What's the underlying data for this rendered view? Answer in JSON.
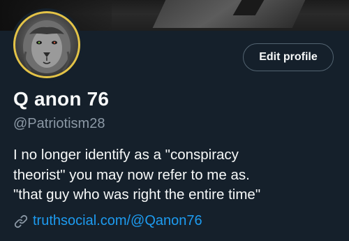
{
  "profile": {
    "edit_button_label": "Edit profile",
    "display_name": "Q anon 76",
    "handle": "@Patriotism28",
    "bio_lines": [
      "I no longer identify as a \"conspiracy",
      "theorist\" you may now refer to me as.",
      "\"that guy who was right the entire time\""
    ],
    "website": "truthsocial.com/@Qanon76"
  },
  "colors": {
    "background": "#15202b",
    "link": "#1d9bf0",
    "secondary_text": "#8b98a5",
    "avatar_border": "#e3c347"
  },
  "icons": {
    "link": "link-icon"
  }
}
